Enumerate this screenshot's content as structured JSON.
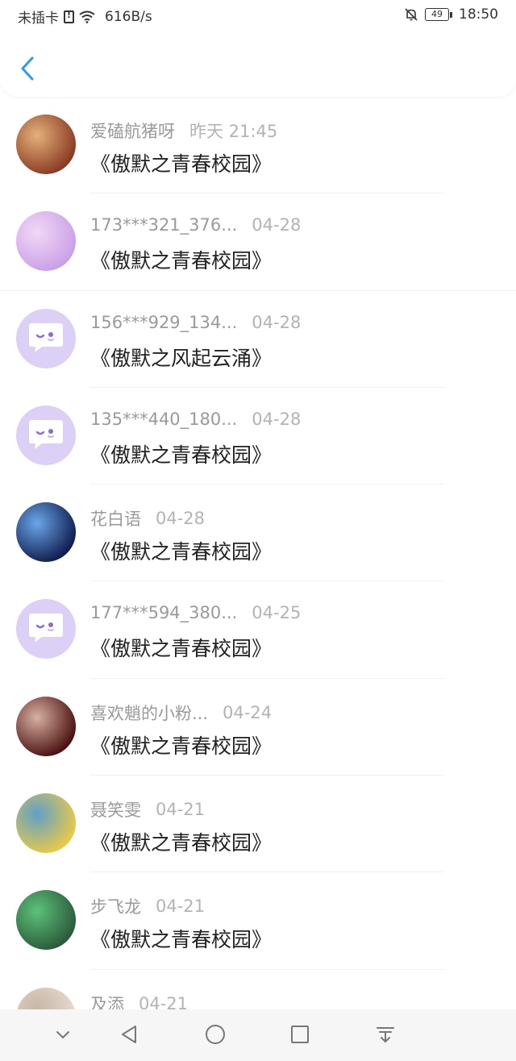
{
  "status_bar": {
    "carrier": "未插卡",
    "speed": "616B/s",
    "battery": "49",
    "time": "18:50"
  },
  "header": {
    "back_icon": "chevron-left-icon",
    "accent": "#2e9bea"
  },
  "list": [
    {
      "name": "爱磕航猪呀",
      "time": "昨天 21:45",
      "content": "《傲默之青春校园》",
      "avatar": "photo",
      "avatar_colors": [
        "#8a3a22",
        "#e3b07a"
      ]
    },
    {
      "name": "173***321_376...",
      "time": "04-28",
      "content": "《傲默之青春校园》",
      "avatar": "photo",
      "avatar_colors": [
        "#c9a0e8",
        "#f2d8f5"
      ]
    },
    {
      "name": "156***929_134...",
      "time": "04-28",
      "content": "《傲默之风起云涌》",
      "avatar": "default",
      "avatar_colors": [
        "#ddd0f7",
        "#9b7bdc"
      ]
    },
    {
      "name": "135***440_180...",
      "time": "04-28",
      "content": "《傲默之青春校园》",
      "avatar": "default",
      "avatar_colors": [
        "#ddd0f7",
        "#9b7bdc"
      ]
    },
    {
      "name": "花白语",
      "time": "04-28",
      "content": "《傲默之青春校园》",
      "avatar": "photo",
      "avatar_colors": [
        "#0f1d4f",
        "#6aa6e8"
      ]
    },
    {
      "name": "177***594_380...",
      "time": "04-25",
      "content": "《傲默之青春校园》",
      "avatar": "default",
      "avatar_colors": [
        "#ddd0f7",
        "#9b7bdc"
      ]
    },
    {
      "name": "喜欢魈的小粉...",
      "time": "04-24",
      "content": "《傲默之青春校园》",
      "avatar": "photo",
      "avatar_colors": [
        "#4a1010",
        "#d8b0a0"
      ]
    },
    {
      "name": "聂笑雯",
      "time": "04-21",
      "content": "《傲默之青春校园》",
      "avatar": "photo",
      "avatar_colors": [
        "#e9c94a",
        "#5fa0c8"
      ]
    },
    {
      "name": "步飞龙",
      "time": "04-21",
      "content": "《傲默之青春校园》",
      "avatar": "photo",
      "avatar_colors": [
        "#2b5a3a",
        "#5cc27a"
      ]
    },
    {
      "name": "及添",
      "time": "04-21",
      "content": "",
      "avatar": "photo",
      "avatar_colors": [
        "#e8dcd0",
        "#c6b6a6"
      ]
    }
  ],
  "nav_bar": {
    "icons": [
      "chevron-down-icon",
      "back-triangle-icon",
      "home-circle-icon",
      "recents-square-icon",
      "notification-pull-icon"
    ]
  }
}
